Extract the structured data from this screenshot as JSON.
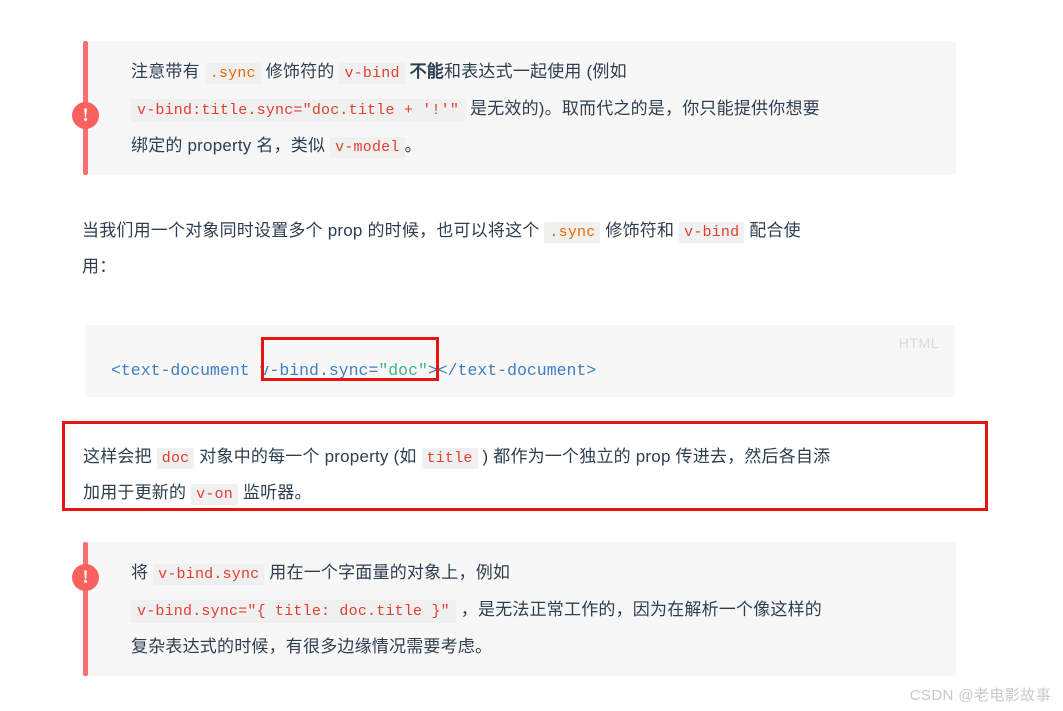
{
  "colors": {
    "page_bg": "#ffffff",
    "tip_bg": "#f7f7f7",
    "tip_accent": "#fa6f6f",
    "badge_bg": "#f9615f",
    "annotation_red": "#e81313",
    "code_chip_bg": "#f0f0f0",
    "code_chip_text": "#e96900",
    "text": "#2c3e50",
    "code_tag": "#3d7fc2",
    "code_string": "#42b983",
    "lang_label": "#d6dadd",
    "watermark": "#c9c9c9"
  },
  "tip_top": {
    "icon": "warning-exclamation-icon",
    "icon_glyph": "!",
    "line1": {
      "t1": "注意带有",
      "code1": ".sync",
      "t2": "修饰符的",
      "code2": "v-bind",
      "bold": "不能",
      "t3": "和表达式一起使用 (例如"
    },
    "line2": {
      "code1": "v-bind:title.sync=\"doc.title + '!'\"",
      "t1": "是无效的)。取而代之的是，你只能提供你想要"
    },
    "line3": {
      "t1": "绑定的 property 名，类似",
      "code1": "v-model",
      "t2": "。"
    }
  },
  "paragraph": {
    "line1": {
      "t1": "当我们用一个对象同时设置多个 prop 的时候，也可以将这个",
      "code1": ".sync",
      "t2": "修饰符和",
      "code2": "v-bind",
      "t3": "配合使"
    },
    "line2": {
      "t1": "用："
    }
  },
  "codeblock": {
    "lang_label": "HTML",
    "tokens": [
      {
        "text": "<text-document ",
        "type": "tag"
      },
      {
        "text": "v-bind.sync=",
        "type": "attr"
      },
      {
        "text": "\"doc\"",
        "type": "string"
      },
      {
        "text": "></text-document>",
        "type": "tag"
      }
    ],
    "full_code": "<text-document v-bind.sync=\"doc\"></text-document>",
    "annotation": "red-highlight-box"
  },
  "red_section": {
    "line1": {
      "t1": "这样会把",
      "code1": "doc",
      "t2": "对象中的每一个 property (如",
      "code2": "title",
      "t3": ") 都作为一个独立的 prop 传进去，然后各自添"
    },
    "line2": {
      "t1": "加用于更新的",
      "code1": "v-on",
      "t2": "监听器。"
    }
  },
  "tip_bottom": {
    "icon": "warning-exclamation-icon",
    "icon_glyph": "!",
    "line1": {
      "t1": "将",
      "code1": "v-bind.sync",
      "t2": "用在一个字面量的对象上，例如"
    },
    "line2": {
      "code1": "v-bind.sync=\"{ title: doc.title }\"",
      "t1": "，是无法正常工作的，因为在解析一个像这样的"
    },
    "line3": {
      "t1": "复杂表达式的时候，有很多边缘情况需要考虑。"
    }
  },
  "watermark": {
    "text": "CSDN @老电影故事"
  }
}
